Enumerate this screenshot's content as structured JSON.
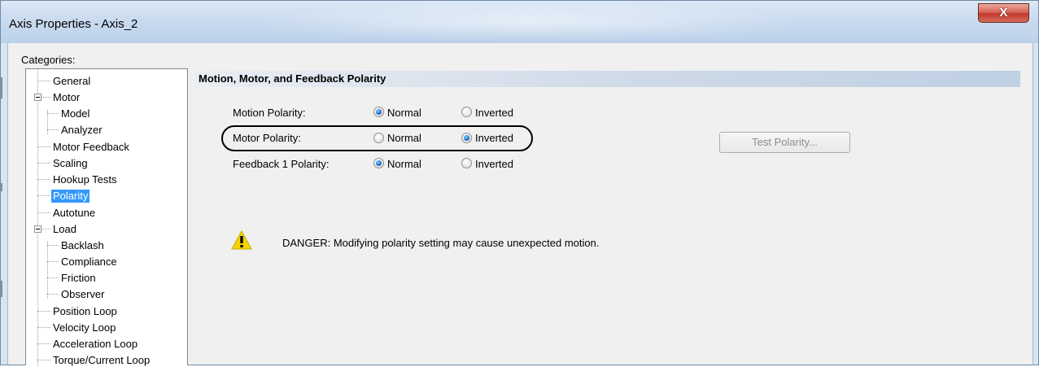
{
  "window": {
    "title": "Axis Properties - Axis_2",
    "close_label": "X"
  },
  "categories_label": "Categories:",
  "tree": {
    "items": [
      {
        "label": "General"
      },
      {
        "label": "Motor"
      },
      {
        "label": "Model"
      },
      {
        "label": "Analyzer"
      },
      {
        "label": "Motor Feedback"
      },
      {
        "label": "Scaling"
      },
      {
        "label": "Hookup Tests"
      },
      {
        "label": "Polarity",
        "selected": true
      },
      {
        "label": "Autotune"
      },
      {
        "label": "Load"
      },
      {
        "label": "Backlash"
      },
      {
        "label": "Compliance"
      },
      {
        "label": "Friction"
      },
      {
        "label": "Observer"
      },
      {
        "label": "Position Loop"
      },
      {
        "label": "Velocity Loop"
      },
      {
        "label": "Acceleration Loop"
      },
      {
        "label": "Torque/Current Loop"
      }
    ]
  },
  "section": {
    "title": "Motion, Motor, and Feedback Polarity"
  },
  "polarity": {
    "rows": [
      {
        "label": "Motion Polarity:",
        "normal": "Normal",
        "inverted": "Inverted",
        "selected": "Normal"
      },
      {
        "label": "Motor Polarity:",
        "normal": "Normal",
        "inverted": "Inverted",
        "selected": "Inverted"
      },
      {
        "label": "Feedback 1 Polarity:",
        "normal": "Normal",
        "inverted": "Inverted",
        "selected": "Normal"
      }
    ]
  },
  "test_button": {
    "label": "Test Polarity...",
    "enabled": false
  },
  "warning": {
    "icon": "warning-triangle-icon",
    "text": "DANGER: Modifying polarity setting may cause unexpected motion."
  },
  "colors": {
    "selection": "#3399ff",
    "header_gradient_end": "#bfd0e3",
    "close_button": "#c1392b",
    "warning_yellow": "#f5d400"
  }
}
